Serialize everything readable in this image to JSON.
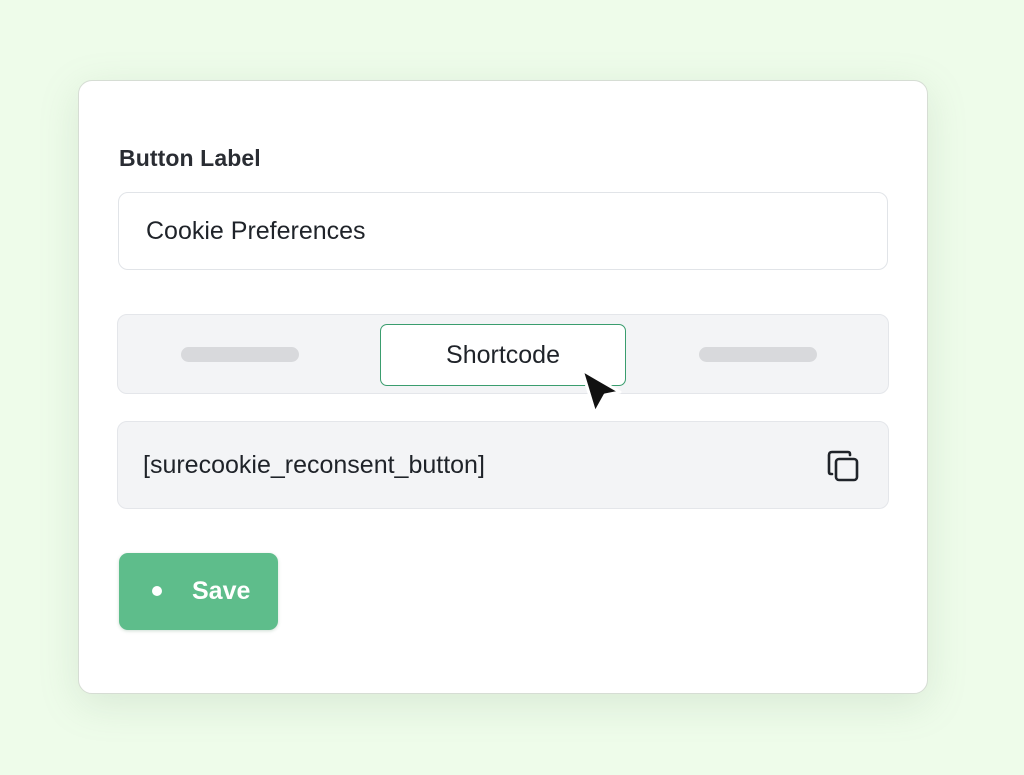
{
  "form": {
    "label": "Button Label",
    "input_value": "Cookie Preferences"
  },
  "tabs": {
    "active_label": "Shortcode"
  },
  "shortcode": {
    "text": "[surecookie_reconsent_button]",
    "icon": "copy-icon"
  },
  "save": {
    "label": "Save"
  },
  "colors": {
    "background": "#eefcea",
    "accent": "#5ebd8b",
    "active_tab_border": "#3a9d6e"
  }
}
